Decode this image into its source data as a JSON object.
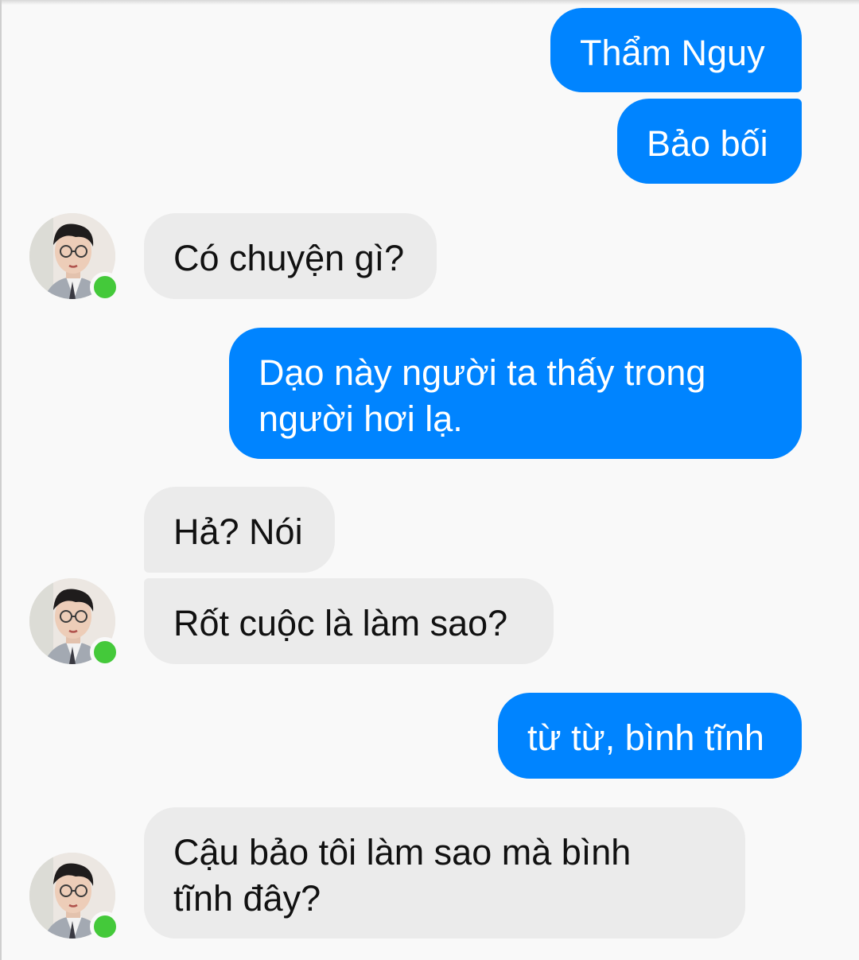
{
  "colors": {
    "outgoing_bubble": "#0084ff",
    "incoming_bubble": "#ebebeb",
    "background": "#f9f9f9",
    "online_dot": "#44c93a"
  },
  "messages": [
    {
      "direction": "outgoing",
      "text": "Thẩm Nguy"
    },
    {
      "direction": "outgoing",
      "text": "Bảo bối"
    },
    {
      "direction": "incoming",
      "text": "Có chuyện gì?"
    },
    {
      "direction": "outgoing",
      "lines": [
        "Dạo này người ta thấy trong",
        "người hơi lạ."
      ]
    },
    {
      "direction": "incoming",
      "text": "Hả? Nói"
    },
    {
      "direction": "incoming",
      "text": "Rốt cuộc là làm sao?"
    },
    {
      "direction": "outgoing",
      "text": "từ từ, bình tĩnh"
    },
    {
      "direction": "incoming",
      "lines": [
        "Cậu bảo tôi làm sao mà bình",
        "tĩnh đây?"
      ]
    }
  ],
  "avatar": {
    "icon": "contact-avatar-icon",
    "status_icon": "online-status-icon"
  }
}
